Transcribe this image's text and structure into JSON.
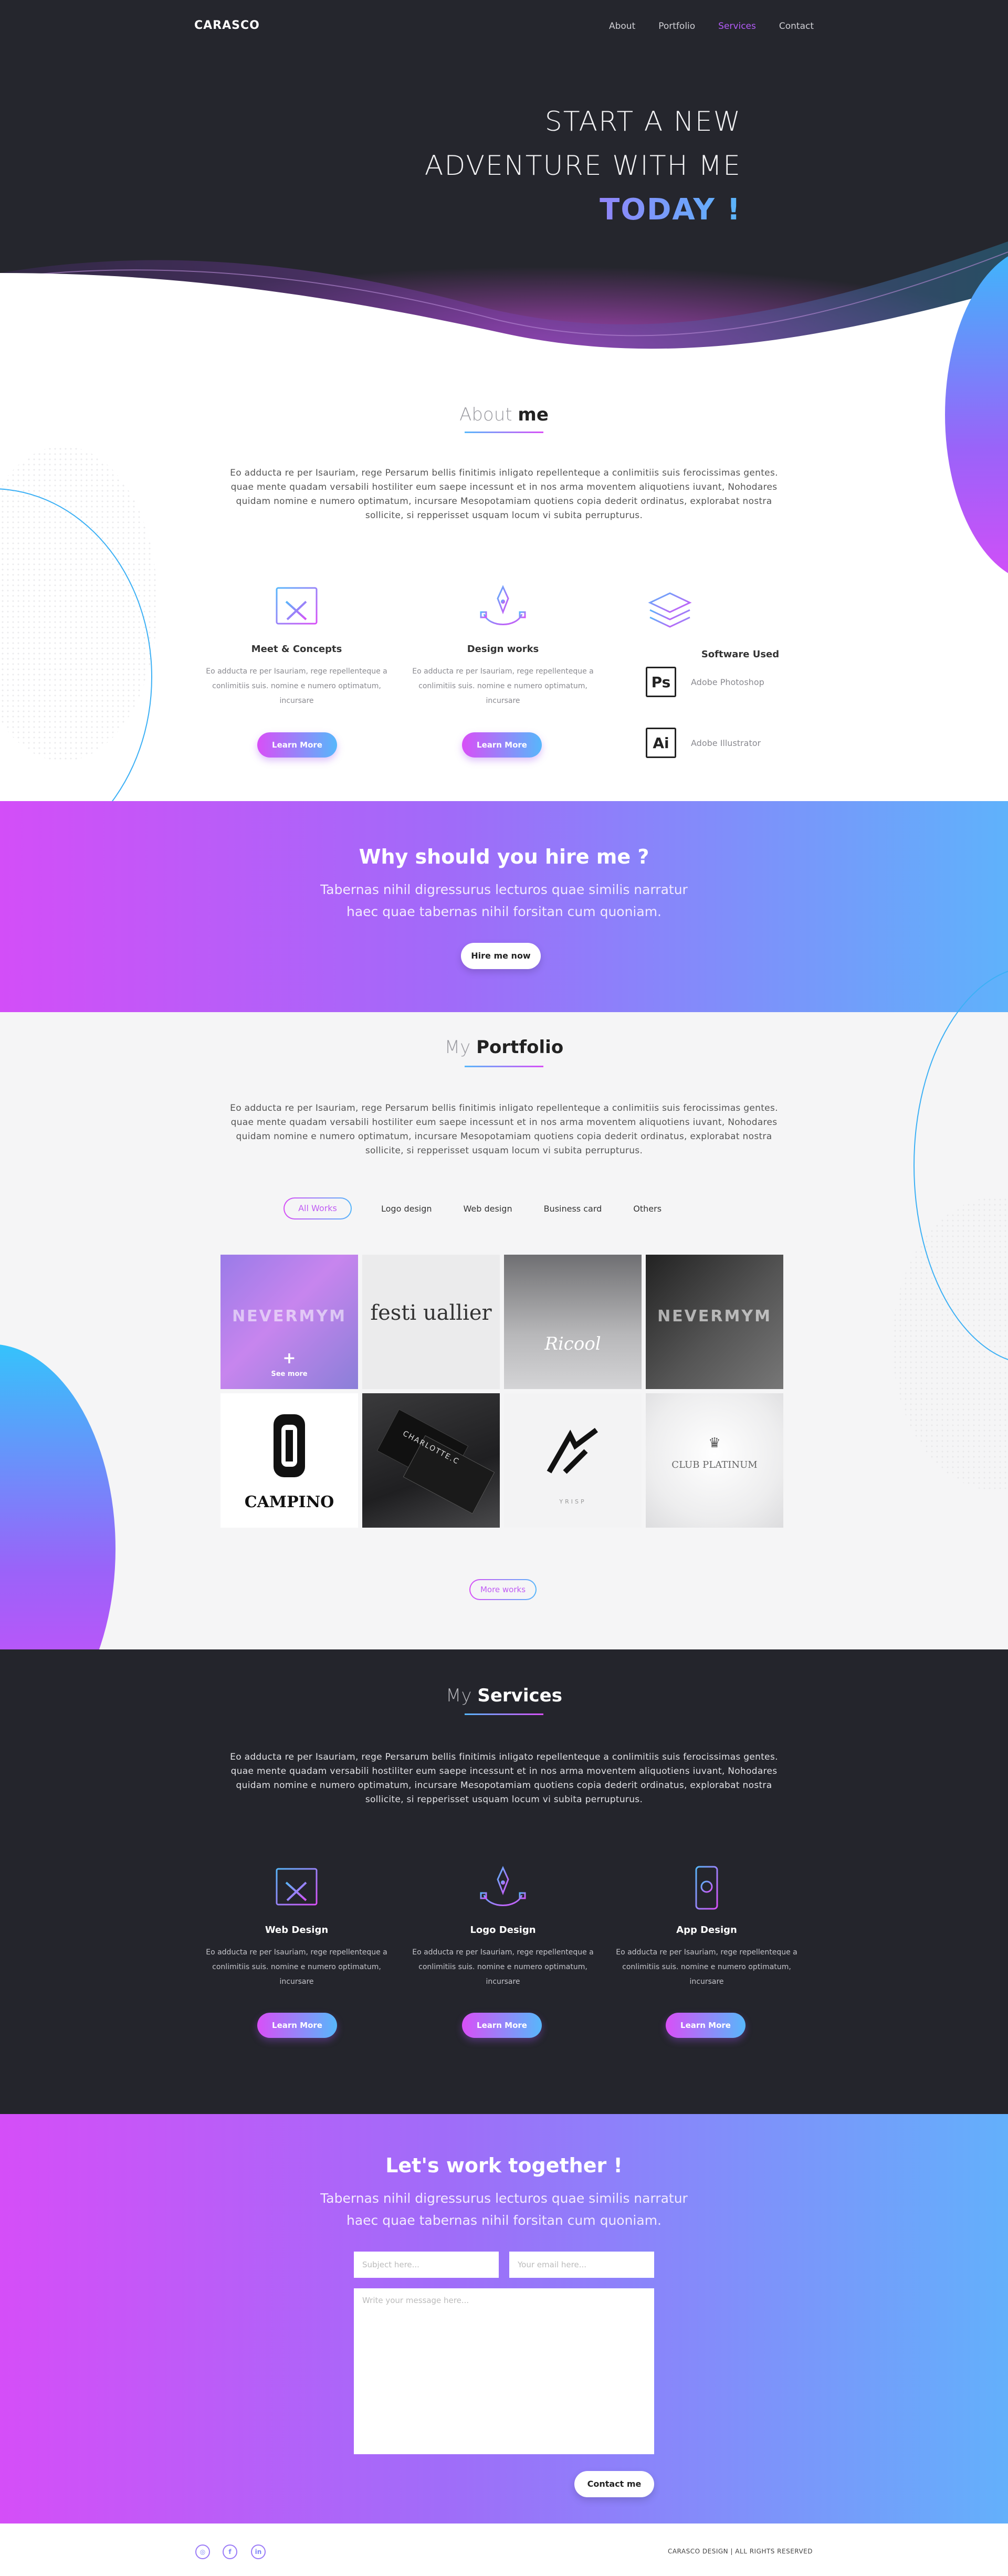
{
  "brand": {
    "logo": "CARASCO"
  },
  "nav": {
    "items": [
      "About",
      "Portfolio",
      "Services",
      "Contact"
    ],
    "active": "Services"
  },
  "hero": {
    "line1": "START A NEW",
    "line2": "ADVENTURE WITH ME",
    "line3": "TODAY !"
  },
  "about": {
    "title_light": "About",
    "title_bold": "me",
    "text": "Eo adducta re per Isauriam, rege Persarum bellis finitimis inligato repellenteque a conlimitiis suis ferocissimas gentes. quae mente quadam versabili hostiliter eum saepe incessunt et in nos arma moventem aliquotiens iuvant, Nohodares quidam nomine e numero optimatum, incursare Mesopotamiam quotiens copia dederit ordinatus, explorabat nostra sollicite, si repperisset usquam locum vi subita perrupturus.",
    "features": [
      {
        "icon": "pencil-ruler-icon",
        "title": "Meet & Concepts",
        "text": "Eo adducta re per Isauriam, rege repellenteque a conlimitiis suis. nomine e numero optimatum, incursare",
        "button": "Learn More"
      },
      {
        "icon": "pen-tool-icon",
        "title": "Design works",
        "text": "Eo adducta re per Isauriam, rege repellenteque a conlimitiis suis. nomine e numero optimatum, incursare",
        "button": "Learn More"
      }
    ],
    "software": {
      "icon": "layers-icon",
      "title": "Software Used",
      "items": [
        {
          "badge": "Ps",
          "name": "Adobe Photoshop"
        },
        {
          "badge": "Ai",
          "name": "Adobe Illustrator"
        }
      ]
    }
  },
  "hire": {
    "title": "Why should you hire me ?",
    "line1": "Tabernas nihil digressurus lecturos quae similis narratur",
    "line2": "haec quae tabernas nihil forsitan cum quoniam.",
    "button": "Hire me now"
  },
  "portfolio": {
    "title_light": "My",
    "title_bold": "Portfolio",
    "text": "Eo adducta re per Isauriam, rege Persarum bellis finitimis inligato repellenteque a conlimitiis suis ferocissimas gentes. quae mente quadam versabili hostiliter eum saepe incessunt et in nos arma moventem aliquotiens iuvant, Nohodares quidam nomine e numero optimatum, incursare Mesopotamiam quotiens copia dederit ordinatus, explorabat nostra sollicite, si repperisset usquam locum vi subita perrupturus.",
    "filters": [
      "All Works",
      "Logo design",
      "Web design",
      "Business card",
      "Others"
    ],
    "active_filter": "All Works",
    "tiles": [
      {
        "logo": "NEVERMYM",
        "caption": "See more"
      },
      {
        "logo": "festi uallier"
      },
      {
        "logo": "Ricool"
      },
      {
        "logo": "NEVERMYM"
      },
      {
        "logo": "CAMPINO"
      },
      {
        "logo": "CHARLOTTE.C"
      },
      {
        "logo": "YRISP"
      },
      {
        "logo": "CLUB PLATINUM"
      }
    ],
    "more_button": "More works"
  },
  "services": {
    "title_light": "My",
    "title_bold": "Services",
    "text": "Eo adducta re per Isauriam, rege Persarum bellis finitimis inligato repellenteque a conlimitiis suis ferocissimas gentes. quae mente quadam versabili hostiliter eum saepe incessunt et in nos arma moventem aliquotiens iuvant, Nohodares quidam nomine e numero optimatum, incursare Mesopotamiam quotiens copia dederit ordinatus, explorabat nostra sollicite, si repperisset usquam locum vi subita perrupturus.",
    "items": [
      {
        "icon": "web-design-icon",
        "title": "Web Design",
        "text": "Eo adducta re per Isauriam, rege repellenteque a conlimitiis suis. nomine e numero optimatum, incursare",
        "button": "Learn More"
      },
      {
        "icon": "pen-tool-icon",
        "title": "Logo Design",
        "text": "Eo adducta re per Isauriam, rege repellenteque a conlimitiis suis. nomine e numero optimatum, incursare",
        "button": "Learn More"
      },
      {
        "icon": "mobile-app-icon",
        "title": "App Design",
        "text": "Eo adducta re per Isauriam, rege repellenteque a conlimitiis suis. nomine e numero optimatum, incursare",
        "button": "Learn More"
      }
    ]
  },
  "contact": {
    "title": "Let's work together !",
    "line1": "Tabernas nihil digressurus lecturos quae similis narratur",
    "line2": "haec quae tabernas nihil forsitan cum quoniam.",
    "subject_placeholder": "Subject here...",
    "email_placeholder": "Your email here...",
    "message_placeholder": "Write your message here...",
    "button": "Contact me"
  },
  "footer": {
    "social": [
      {
        "icon": "dribbble-icon",
        "glyph": "◎"
      },
      {
        "icon": "facebook-icon",
        "glyph": "f"
      },
      {
        "icon": "linkedin-icon",
        "glyph": "in"
      }
    ],
    "copyright": "CARASCO DESIGN | ALL RIGHTS RESERVED"
  },
  "colors": {
    "accent_pink": "#d84ff7",
    "accent_blue": "#57b7fb",
    "dark": "#24252c"
  }
}
